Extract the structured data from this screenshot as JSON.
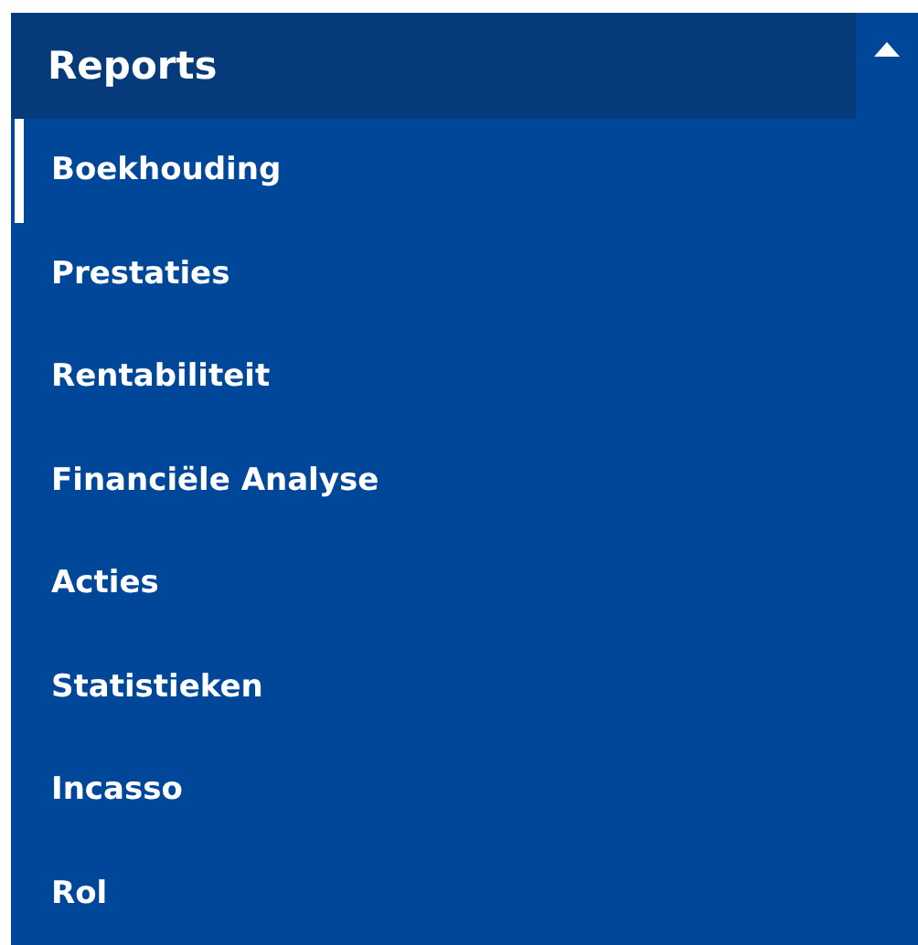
{
  "menu": {
    "title": "Reports",
    "expanded": true,
    "items": [
      {
        "label": "Boekhouding",
        "selected": true
      },
      {
        "label": "Prestaties",
        "selected": false
      },
      {
        "label": "Rentabiliteit",
        "selected": false
      },
      {
        "label": "Financiële Analyse",
        "selected": false
      },
      {
        "label": "Acties",
        "selected": false
      },
      {
        "label": "Statistieken",
        "selected": false
      },
      {
        "label": "Incasso",
        "selected": false
      },
      {
        "label": "Rol",
        "selected": false
      }
    ]
  }
}
